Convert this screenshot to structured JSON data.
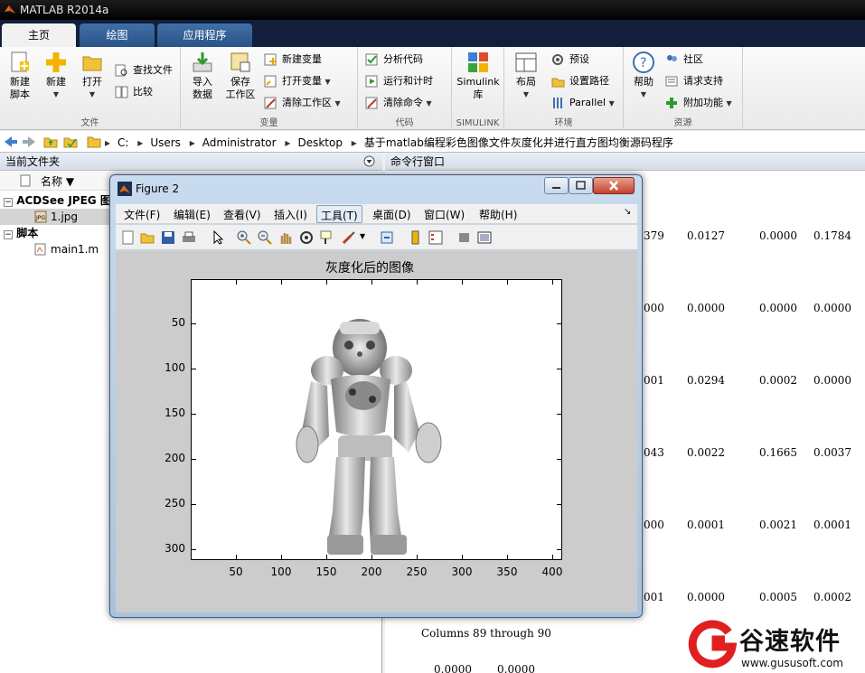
{
  "app": {
    "title": "MATLAB R2014a"
  },
  "tabs": [
    "主页",
    "绘图",
    "应用程序"
  ],
  "ribbon": {
    "file": {
      "caption": "文件",
      "new_script": "新建\n脚本",
      "new": "新建",
      "open": "打开",
      "find_files": "查找文件",
      "compare": "比较"
    },
    "variable": {
      "caption": "变量",
      "import": "导入\n数据",
      "save_ws": "保存\n工作区",
      "new_var": "新建变量",
      "open_var": "打开变量",
      "clear_ws": "清除工作区"
    },
    "code": {
      "caption": "代码",
      "analyze": "分析代码",
      "run_time": "运行和计时",
      "clear_cmds": "清除命令"
    },
    "simulink": {
      "caption": "SIMULINK",
      "lib": "Simulink\n库"
    },
    "env": {
      "caption": "环境",
      "layout": "布局",
      "prefs": "预设",
      "set_path": "设置路径",
      "parallel": "Parallel"
    },
    "resources": {
      "caption": "资源",
      "help": "帮助",
      "community": "社区",
      "support": "请求支持",
      "addons": "附加功能"
    }
  },
  "address": [
    "C:",
    "Users",
    "Administrator",
    "Desktop",
    "基于matlab编程彩色图像文件灰度化并进行直方图均衡源码程序"
  ],
  "panels": {
    "current_folder": "当前文件夹",
    "command_window": "命令行窗口",
    "col_name": "名称 ▼"
  },
  "tree": [
    {
      "label": "ACDSee JPEG 图像",
      "bold": true
    },
    {
      "label": "1.jpg",
      "bold": false
    },
    {
      "label": "脚本",
      "bold": true
    },
    {
      "label": "main1.m",
      "bold": false
    }
  ],
  "command": {
    "rows": [
      [
        "379",
        "0.0127",
        "0.0000",
        "0.1784"
      ],
      [
        "000",
        "0.0000",
        "0.0000",
        "0.0000"
      ],
      [
        "001",
        "0.0294",
        "0.0002",
        "0.0000"
      ],
      [
        "043",
        "0.0022",
        "0.1665",
        "0.0037"
      ],
      [
        "000",
        "0.0001",
        "0.0021",
        "0.0001"
      ],
      [
        "001",
        "0.0000",
        "0.0005",
        "0.0002"
      ]
    ],
    "columns_line": "Columns 89 through 90",
    "last_values": [
      "0.0000",
      "0.0000"
    ]
  },
  "figure": {
    "title": "Figure 2",
    "menu": [
      "文件(F)",
      "编辑(E)",
      "查看(V)",
      "插入(I)",
      "工具(T)",
      "桌面(D)",
      "窗口(W)",
      "帮助(H)"
    ],
    "plot_title": "灰度化后的图像",
    "yticks": [
      "50",
      "100",
      "150",
      "200",
      "250",
      "300"
    ],
    "xticks": [
      "50",
      "100",
      "150",
      "200",
      "250",
      "300",
      "350",
      "400"
    ]
  },
  "watermark": {
    "name": "谷速软件",
    "url": "www.gususoft.com"
  },
  "colors": {
    "titlebar": "#000000",
    "tabbar": "#121f3b",
    "figure_frame": "#a9c3df",
    "watermark_red": "#e02020"
  }
}
